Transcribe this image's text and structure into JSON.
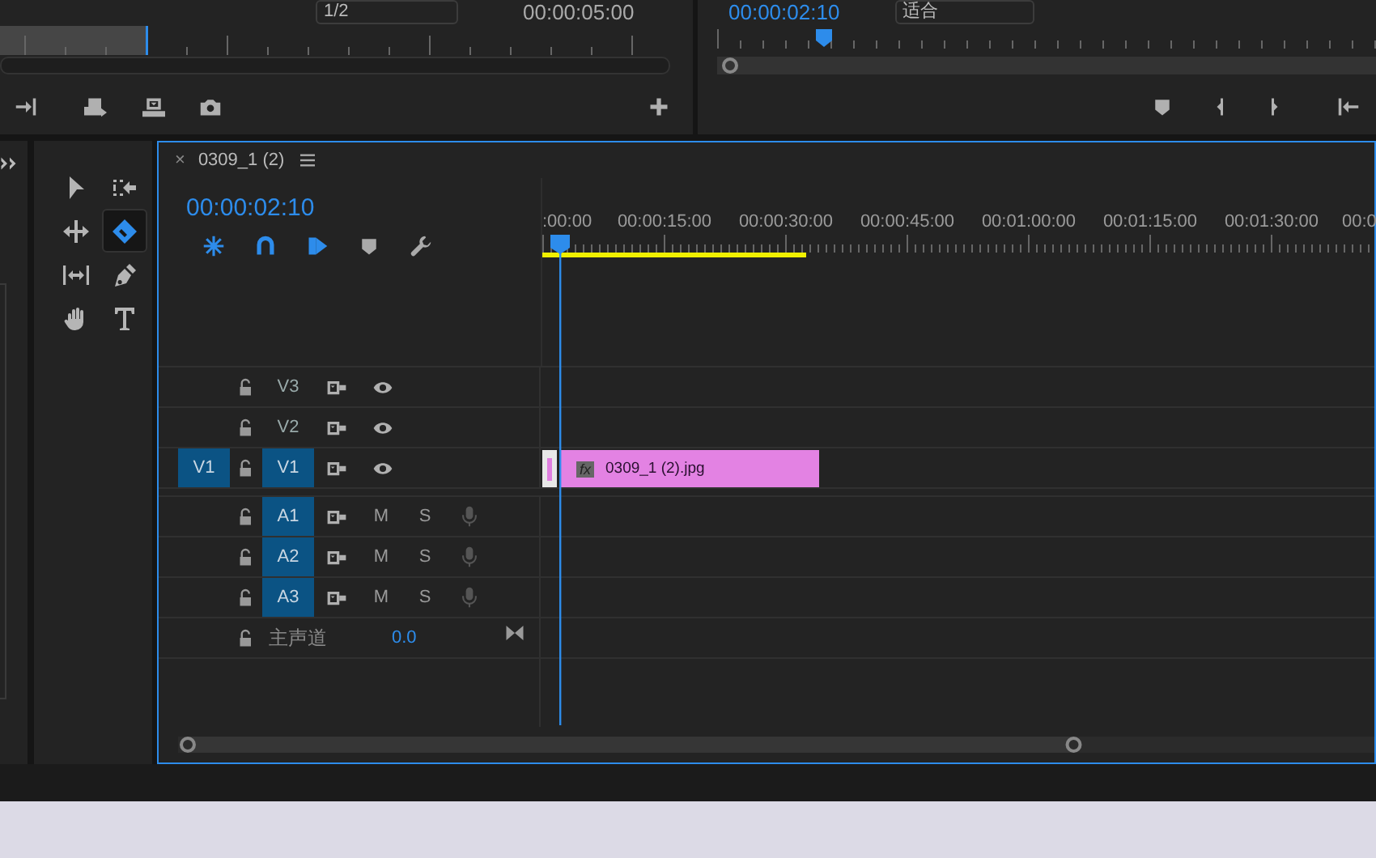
{
  "source_monitor": {
    "zoom": "1/2",
    "timecode": "00:00:05:00"
  },
  "program_monitor": {
    "timecode": "00:00:02:10",
    "zoom": "适合"
  },
  "tools": [
    {
      "kind": "selection",
      "selected": false
    },
    {
      "kind": "track-select",
      "selected": false
    },
    {
      "kind": "ripple",
      "selected": false
    },
    {
      "kind": "razor",
      "selected": true
    },
    {
      "kind": "slip",
      "selected": false
    },
    {
      "kind": "pen",
      "selected": false
    },
    {
      "kind": "hand",
      "selected": false
    },
    {
      "kind": "type",
      "selected": false
    }
  ],
  "timeline": {
    "close": "×",
    "title": "0309_1 (2)",
    "timecode": "00:00:02:10",
    "ruler_labels": [
      ":00:00",
      "00:00:15:00",
      "00:00:30:00",
      "00:00:45:00",
      "00:01:00:00",
      "00:01:15:00",
      "00:01:30:00",
      "00:0"
    ],
    "video_tracks": [
      {
        "name": "V3",
        "targeted": false
      },
      {
        "name": "V2",
        "targeted": false
      },
      {
        "name": "V1",
        "targeted": true,
        "source": "V1",
        "clips": [
          {
            "name": "0309_1 (2).jpg",
            "fx": "fx"
          }
        ]
      }
    ],
    "audio_tracks": [
      {
        "name": "A1",
        "targeted": true,
        "mute": "M",
        "solo": "S"
      },
      {
        "name": "A2",
        "targeted": true,
        "mute": "M",
        "solo": "S"
      },
      {
        "name": "A3",
        "targeted": true,
        "mute": "M",
        "solo": "S"
      }
    ],
    "master": {
      "label": "主声道",
      "value": "0.0"
    }
  }
}
